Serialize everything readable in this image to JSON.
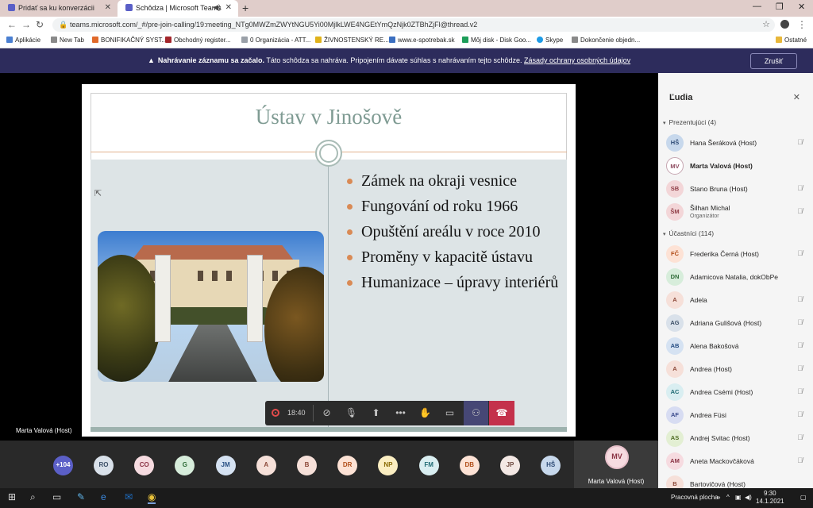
{
  "browser": {
    "tabs": [
      {
        "title": "Pridať sa ku konverzácii",
        "active": false
      },
      {
        "title": "Schôdza | Microsoft Teams",
        "active": true
      }
    ],
    "url": "teams.microsoft.com/_#/pre-join-calling/19:meeting_NTg0MWZmZWYtNGU5Yi00MjlkLWE4NGEtYmQzNjk0ZTBhZjFl@thread.v2",
    "bookmarks": [
      {
        "label": "Aplikácie",
        "icon": "apps-grid-icon",
        "color": "#4a7fd1"
      },
      {
        "label": "New Tab",
        "icon": "page-icon",
        "color": "#8a8a8a"
      },
      {
        "label": "BONIFIKAČNÝ SYST...",
        "icon": "asterisk-icon",
        "color": "#e16a2b"
      },
      {
        "label": "Obchodný register...",
        "icon": "register-icon",
        "color": "#a3262b"
      },
      {
        "label": "0 Organizácia - ATT...",
        "icon": "org-icon",
        "color": "#9aa0a8"
      },
      {
        "label": "ŽIVNOSTENSKÝ RE...",
        "icon": "trade-icon",
        "color": "#e0b21b"
      },
      {
        "label": "www.e-spotrebak.sk",
        "icon": "site-icon",
        "color": "#3b6fc0"
      },
      {
        "label": "Môj disk - Disk Goo...",
        "icon": "drive-icon",
        "color": "#1e9e5a"
      },
      {
        "label": "Skype",
        "icon": "skype-icon",
        "color": "#1e9be6"
      },
      {
        "label": "Dokončenie objedn...",
        "icon": "page-icon",
        "color": "#8a8a8a"
      }
    ],
    "other_bookmarks": "Ostatné"
  },
  "banner": {
    "bold": "Nahrávanie záznamu sa začalo.",
    "text": " Táto schôdza sa nahráva. Pripojením dávate súhlas s nahrávaním tejto schôdze. ",
    "link": "Zásady ochrany osobných údajov",
    "dismiss": "Zrušiť"
  },
  "slide": {
    "title": "Ústav v Jinošově",
    "bullets": [
      "Zámek na okraji vesnice",
      "Fungování od roku 1966",
      "Opuštění areálu v roce 2010",
      "Proměny v kapacitě ústavu",
      "Humanizace – úpravy interiérů"
    ]
  },
  "presenter": "Marta Valová (Host)",
  "controls": {
    "timer": "18:40"
  },
  "panel": {
    "title": "Ľudia",
    "presenters_label": "Prezentujúci (4)",
    "attendees_label": "Účastníci (114)",
    "presenters": [
      {
        "initials": "HŠ",
        "name": "Hana Šeráková (Host)",
        "cls": "av-hs"
      },
      {
        "initials": "MV",
        "name": "Marta Valová (Host)",
        "cls": "av-mv"
      },
      {
        "initials": "SB",
        "name": "Stano Bruna (Host)",
        "cls": "av-sb"
      },
      {
        "initials": "ŠM",
        "name": "Šilhan Michal",
        "role": "Organizátor",
        "cls": "av-sm"
      }
    ],
    "attendees": [
      {
        "initials": "FČ",
        "name": "Frederika Černá (Host)",
        "cls": "av-fc"
      },
      {
        "initials": "DN",
        "name": "Adamicova Natalia, dokObPe",
        "cls": "av-dn"
      },
      {
        "initials": "A",
        "name": "Adela",
        "cls": "av-a"
      },
      {
        "initials": "AG",
        "name": "Adriana Gulišová (Host)",
        "cls": "av-ag"
      },
      {
        "initials": "AB",
        "name": "Alena Bakošová",
        "cls": "av-ab"
      },
      {
        "initials": "A",
        "name": "Andrea (Host)",
        "cls": "av-a"
      },
      {
        "initials": "AC",
        "name": "Andrea Csémi (Host)",
        "cls": "av-ac"
      },
      {
        "initials": "AF",
        "name": "Andrea Füsi",
        "cls": "av-af"
      },
      {
        "initials": "AS",
        "name": "Andrej Svitac (Host)",
        "cls": "av-as"
      },
      {
        "initials": "AM",
        "name": "Aneta Mackovčáková",
        "cls": "av-am"
      },
      {
        "initials": "B",
        "name": "Bartovičová (Host)",
        "cls": "av-b"
      }
    ]
  },
  "gallery": {
    "more": "+104",
    "avatars": [
      {
        "initials": "RO",
        "bg": "#d9e1ea",
        "fg": "#3b4e66"
      },
      {
        "initials": "CO",
        "bg": "#f6dbe0",
        "fg": "#8a3344"
      },
      {
        "initials": "G",
        "bg": "#d7eddb",
        "fg": "#2e6b37"
      },
      {
        "initials": "JM",
        "bg": "#d5e2f2",
        "fg": "#274f84"
      },
      {
        "initials": "A",
        "bg": "#f6e0d9",
        "fg": "#8d4a3a"
      },
      {
        "initials": "B",
        "bg": "#f6e0d9",
        "fg": "#8d4a3a"
      },
      {
        "initials": "DR",
        "bg": "#fde2d5",
        "fg": "#b14d18"
      },
      {
        "initials": "NP",
        "bg": "#fbeec2",
        "fg": "#8a6b06"
      },
      {
        "initials": "FM",
        "bg": "#d9eef1",
        "fg": "#1e6a73"
      },
      {
        "initials": "DB",
        "bg": "#fde2d5",
        "fg": "#b14d18"
      },
      {
        "initials": "JP",
        "bg": "#f3e8e4",
        "fg": "#6e4a40"
      },
      {
        "initials": "HŠ",
        "bg": "#c7d8ec",
        "fg": "#2e4b76"
      }
    ],
    "self": {
      "initials": "MV",
      "name": "Marta Valová (Host)"
    }
  },
  "taskbar": {
    "desktop_label": "Pracovná plocha",
    "time": "9:30",
    "date": "14.1.2021"
  }
}
